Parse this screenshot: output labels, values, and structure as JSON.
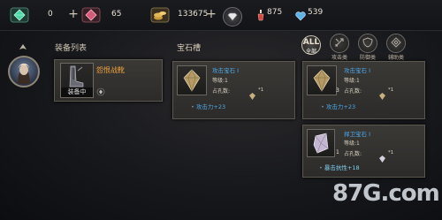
{
  "resources": {
    "emerald": {
      "value": "0",
      "plus": "+"
    },
    "ruby": {
      "value": "65",
      "plus": "+"
    },
    "gold": {
      "value": "133675",
      "plus": "+"
    },
    "stat_red": "875",
    "stat_blue": "539"
  },
  "left_panel": {
    "title": "装备列表"
  },
  "equipment": {
    "name": "怨恨战靴",
    "tag": "装备中"
  },
  "gem_slot": {
    "title": "宝石槽"
  },
  "gem_cards": [
    {
      "title": "攻击宝石 I",
      "level": "等级:1",
      "holes_label": "占孔数:",
      "holes_count": "*1",
      "stat": "攻击力+23",
      "qty": ""
    },
    {
      "title": "攻击宝石 I",
      "level": "等级:1",
      "holes_label": "占孔数:",
      "holes_count": "*1",
      "stat": "攻击力+23",
      "qty": "3"
    },
    {
      "title": "捍卫宝石 I",
      "level": "等级:1",
      "holes_label": "占孔数:",
      "holes_count": "*1",
      "stat": "暴击抗性+18",
      "qty": "1"
    }
  ],
  "filters": [
    {
      "big": "ALL",
      "label": "全部"
    },
    {
      "label": "攻击类"
    },
    {
      "label": "防御类"
    },
    {
      "label": "辅助类"
    }
  ],
  "watermark": "87G.com",
  "colors": {
    "gem_title_blue": "#4da6e8",
    "equip_orange": "#f0a33a",
    "panel": "#2c2b29"
  }
}
